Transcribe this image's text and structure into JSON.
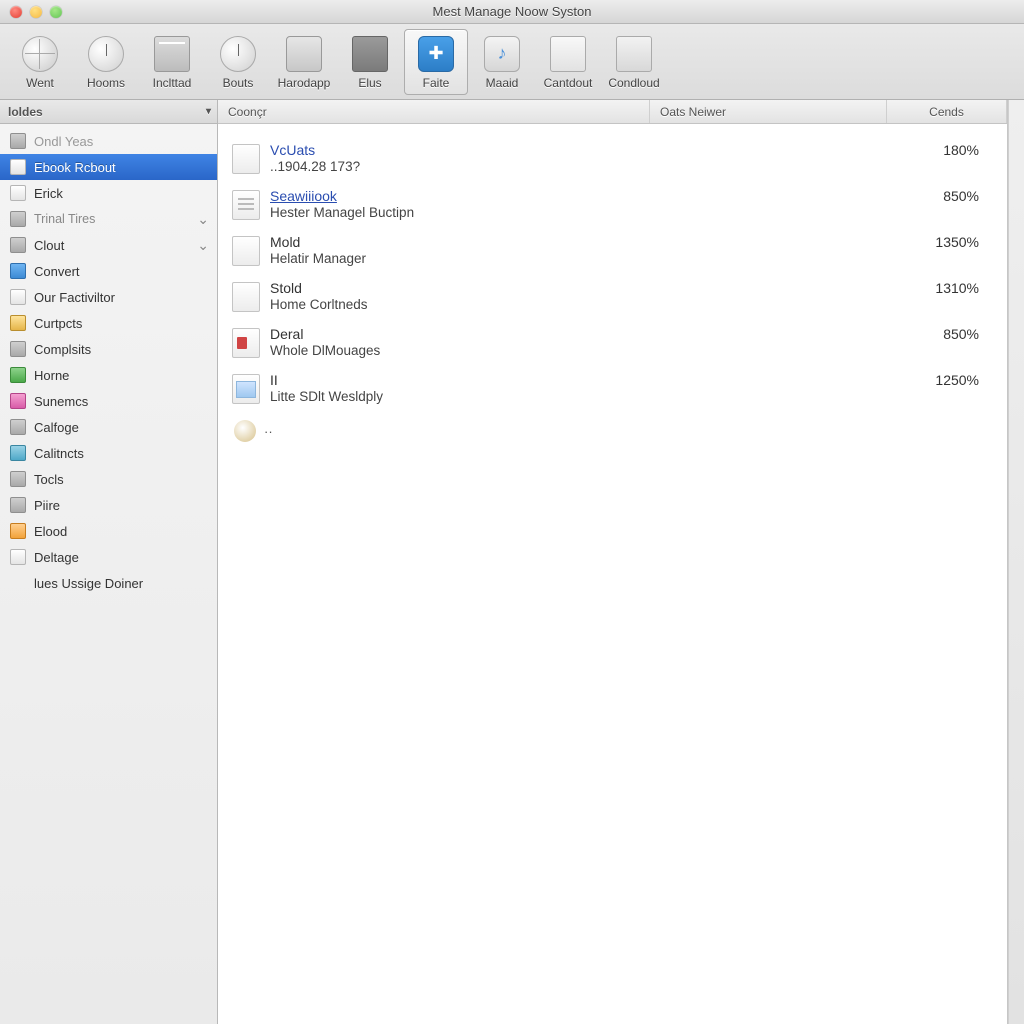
{
  "window": {
    "title": "Mest Manage Noow Syston"
  },
  "toolbar": [
    {
      "id": "went",
      "label": "Went",
      "icon": "globe-icon",
      "active": false
    },
    {
      "id": "hooms",
      "label": "Hooms",
      "icon": "clock-icon",
      "active": false
    },
    {
      "id": "inclttad",
      "label": "Inclttad",
      "icon": "book-icon",
      "active": false
    },
    {
      "id": "bouts",
      "label": "Bouts",
      "icon": "clock-icon",
      "active": false
    },
    {
      "id": "harodapp",
      "label": "Harodapp",
      "icon": "monitor-icon",
      "active": false
    },
    {
      "id": "elus",
      "label": "Elus",
      "icon": "folder-icon",
      "active": false
    },
    {
      "id": "faite",
      "label": "Faite",
      "icon": "app-icon",
      "active": true
    },
    {
      "id": "maaid",
      "label": "Maaid",
      "icon": "music-icon",
      "active": false
    },
    {
      "id": "cantdout",
      "label": "Cantdout",
      "icon": "page-icon",
      "active": false
    },
    {
      "id": "condloud",
      "label": "Condloud",
      "icon": "cloud-icon",
      "active": false
    }
  ],
  "sidebar": {
    "header": "loldes",
    "items": [
      {
        "label": "Ondl Yeas",
        "icon": "gray",
        "dim": true
      },
      {
        "label": "Ebook Rcbout",
        "icon": "doc",
        "selected": true
      },
      {
        "label": "Erick",
        "icon": "doc"
      },
      {
        "label": "Trinal Tires",
        "icon": "gray",
        "section": true,
        "expandable": true
      },
      {
        "label": "Clout",
        "icon": "gray",
        "expandable": true
      },
      {
        "label": "Convert",
        "icon": "blue"
      },
      {
        "label": "Our Factiviltor",
        "icon": "doc"
      },
      {
        "label": "Curtpcts",
        "icon": "folder"
      },
      {
        "label": "Complsits",
        "icon": "gray"
      },
      {
        "label": "Horne",
        "icon": "green"
      },
      {
        "label": "Sunemcs",
        "icon": "pink"
      },
      {
        "label": "Calfoge",
        "icon": "gray"
      },
      {
        "label": "Calitncts",
        "icon": "teal"
      },
      {
        "label": "Tocls",
        "icon": "gray"
      },
      {
        "label": "Piire",
        "icon": "gray"
      },
      {
        "label": "Elood",
        "icon": "orange"
      },
      {
        "label": "Deltage",
        "icon": "doc"
      },
      {
        "label": "lues Ussige Doiner",
        "icon": "none"
      }
    ]
  },
  "columns": {
    "name": "Coonçr",
    "mid": "Oats Neiwer",
    "end": "Cends"
  },
  "files": [
    {
      "icon": "doc",
      "title": "VcUats",
      "title_style": "link-plain",
      "sub": "..1904.28 173?",
      "pct": "180%"
    },
    {
      "icon": "text",
      "title": "Seawiiiook",
      "title_style": "link",
      "sub": "Hester Managel Buctipn",
      "pct": "850%"
    },
    {
      "icon": "folder",
      "title": "Mold",
      "title_style": "plain",
      "sub": "Helatir Manager",
      "pct": "1350%"
    },
    {
      "icon": "doc",
      "title": "Stold",
      "title_style": "plain",
      "sub": "Home Corltneds",
      "pct": "1310%"
    },
    {
      "icon": "red",
      "title": "Deral",
      "title_style": "plain",
      "sub": "Whole DlMouages",
      "pct": "850%"
    },
    {
      "icon": "img",
      "title": "II",
      "title_style": "plain",
      "sub": "Litte SDlt Wesldply",
      "pct": "1250%"
    }
  ],
  "more": {
    "label": "··"
  }
}
